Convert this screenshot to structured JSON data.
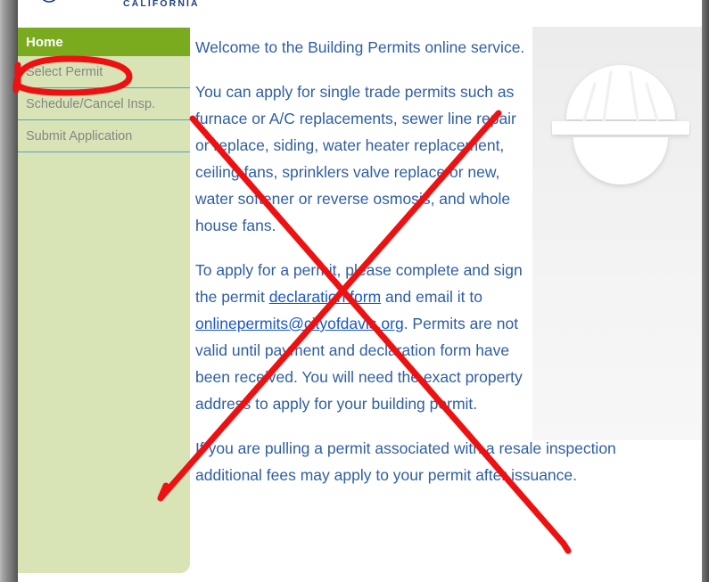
{
  "header": {
    "logo_text": "CALIFORNIA",
    "logo_icon": "city-seal-arc-logo"
  },
  "sidebar": {
    "items": [
      {
        "label": "Home",
        "state": "active"
      },
      {
        "label": "Select Permit",
        "state": "default"
      },
      {
        "label": "Schedule/Cancel Insp.",
        "state": "default"
      },
      {
        "label": "Submit Application",
        "state": "default"
      }
    ]
  },
  "content": {
    "paragraphs": {
      "p1": "Welcome to the Building Permits online service.",
      "p2": "You can apply for single trade permits such as furnace or A/C replacements, sewer line repair or replace, siding, water heater replacement, ceiling fans, sprinklers valve replace or new, water softener or reverse osmosis, and whole house fans.",
      "p3_before_link": "To apply for a permit, please complete and sign the permit ",
      "p3_link_form": "declaration form",
      "p3_mid": " and email it to ",
      "p3_link_email": "onlinepermits@cityofdavis.org",
      "p3_after": ". Permits are not valid until payment and declaration form have been received. You will need the exact property address to apply for your building permit.",
      "p4": "If you are pulling a permit associated with a resale inspection additional fees may apply to your permit after issuance."
    }
  },
  "hero": {
    "icon": "hard-hat-icon"
  },
  "annotations": {
    "ellipse": {
      "target": "Select Permit",
      "color": "#ee1111"
    },
    "cross_mark": {
      "target": "main content area",
      "color": "#ee1111"
    }
  },
  "colors": {
    "nav_active_green": "#7aab1f",
    "nav_light_green": "#d9e4b6",
    "nav_separator_blue": "#55a0c6",
    "body_text_blue": "#2f5ea3",
    "link_blue": "#1a57cc",
    "nav_item_gray": "#858585",
    "logo_blue": "#1d3f7a",
    "annotation_red": "#ee1111"
  }
}
